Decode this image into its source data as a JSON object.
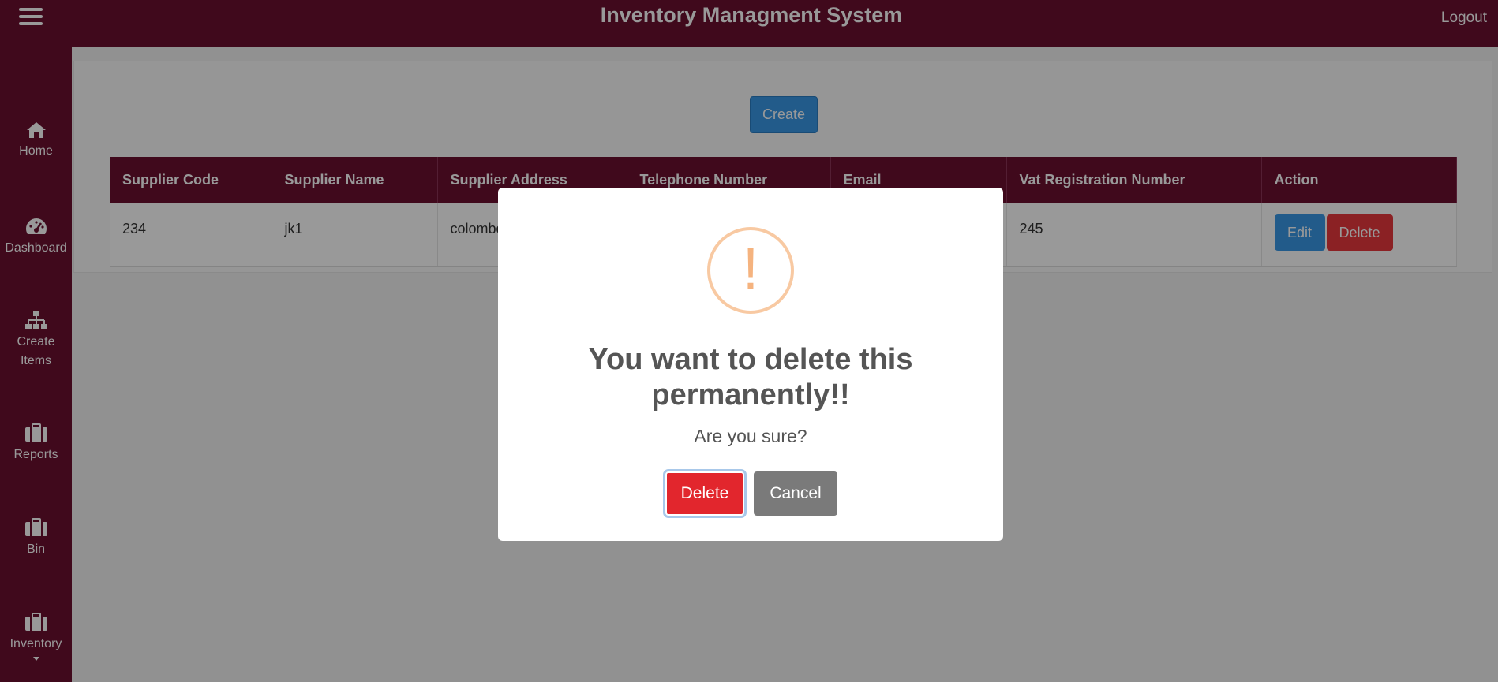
{
  "header": {
    "title": "Inventory Managment System",
    "logout_label": "Logout"
  },
  "sidebar": {
    "items": [
      {
        "label": "Home",
        "icon": "home-icon"
      },
      {
        "label": "Dashboard",
        "icon": "dashboard-icon"
      },
      {
        "label": "Create Items",
        "icon": "sitemap-icon"
      },
      {
        "label": "Reports",
        "icon": "briefcase-icon"
      },
      {
        "label": "Bin",
        "icon": "briefcase-icon"
      },
      {
        "label": "Inventory",
        "icon": "briefcase-icon"
      }
    ]
  },
  "toolbar": {
    "create_label": "Create"
  },
  "table": {
    "headers": [
      "Supplier Code",
      "Supplier Name",
      "Supplier Address",
      "Telephone Number",
      "Email",
      "Vat Registration Number",
      "Action"
    ],
    "rows": [
      {
        "code": "234",
        "name": "jk1",
        "address": "colombo",
        "telephone": "",
        "email": "",
        "vat": "245",
        "edit_label": "Edit",
        "delete_label": "Delete"
      }
    ]
  },
  "modal": {
    "icon_glyph": "!",
    "title": "You want to delete this permanently!!",
    "text": "Are you sure?",
    "confirm_label": "Delete",
    "cancel_label": "Cancel"
  },
  "colors": {
    "brand": "#6b1030",
    "primary": "#3a98e6",
    "danger": "#e2262d",
    "warning": "#f8c9a2"
  }
}
